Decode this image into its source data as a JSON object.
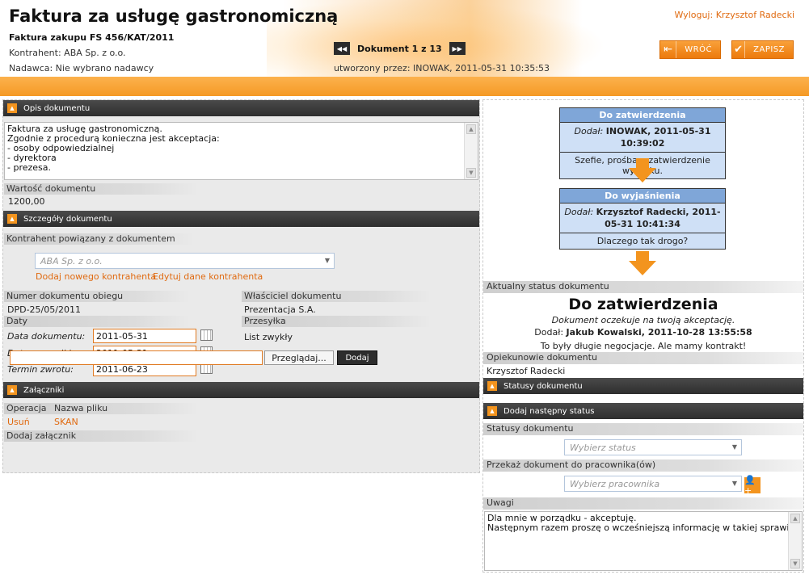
{
  "header": {
    "title": "Faktura za usługę gastronomiczną",
    "subtitle": "Faktura zakupu FS 456/KAT/2011",
    "contractor": "Kontrahent: ABA Sp. z o.o.",
    "sender": "Nadawca: Nie wybrano nadawcy",
    "logout": "Wyloguj: Krzysztof Radecki",
    "pager_text": "Dokument 1 z 13",
    "created_by": "utworzony przez: INOWAK, 2011-05-31 10:35:53",
    "back_label": "WRÓĆ",
    "save_label": "ZAPISZ"
  },
  "left": {
    "opis_title": "Opis dokumentu",
    "opis_lines": [
      "Faktura za usługę gastronomiczną.",
      "Zgodnie z procedurą konieczna jest akceptacja:",
      "- osoby odpowiedzialnej",
      "- dyrektora",
      "- prezesa."
    ],
    "value_label": "Wartość dokumentu",
    "value": "1200,00",
    "details_title": "Szczegóły dokumentu",
    "contractor_label": "Kontrahent powiązany z dokumentem",
    "contractor_select": "ABA Sp. z o.o.",
    "add_contractor": "Dodaj nowego kontrahenta",
    "edit_contractor": "Edytuj dane kontrahenta",
    "doc_number_label": "Numer dokumentu obiegu",
    "doc_number": "DPD-25/05/2011",
    "owner_label": "Właściciel dokumentu",
    "owner": "Prezentacja S.A.",
    "dates_label": "Daty",
    "shipment_label": "Przesyłka",
    "shipment": "List zwykły",
    "date_doc_label": "Data dokumentu:",
    "date_doc": "2011-05-31",
    "date_ship_label": "Data przesyłki:",
    "date_ship": "2011-05-31",
    "date_return_label": "Termin zwrotu:",
    "date_return": "2011-06-23",
    "attachments_title": "Załączniki",
    "col_operation": "Operacja",
    "col_filename": "Nazwa pliku",
    "delete_link": "Usuń",
    "file_name": "SKAN",
    "add_attachment_label": "Dodaj załącznik",
    "browse_label": "Przeglądaj...",
    "add_label": "Dodaj"
  },
  "right": {
    "wf1": {
      "status": "Do zatwierdzenia",
      "by_prefix": "Dodał:",
      "by": "INOWAK, 2011-05-31 10:39:02",
      "note": "Szefie, prośba o zatwierdzenie wydatku."
    },
    "wf2": {
      "status": "Do wyjaśnienia",
      "by_prefix": "Dodał:",
      "by": "Krzysztof Radecki, 2011-05-31 10:41:34",
      "note": "Dlaczego tak drogo?"
    },
    "current_status_label": "Aktualny status dokumentu",
    "current_status": "Do zatwierdzenia",
    "current_note": "Dokument oczekuje na twoją akceptację.",
    "current_by_prefix": "Dodał:",
    "current_by": "Jakub Kowalski, 2011-10-28 13:55:58",
    "current_comment": "To były długie negocjacje. Ale mamy kontrakt!",
    "guardians_label": "Opiekunowie dokumentu",
    "guardian": "Krzysztof Radecki",
    "statuses_title": "Statusy dokumentu",
    "add_status_title": "Dodaj następny status",
    "statuses_label": "Statusy dokumentu",
    "status_select": "Wybierz status",
    "forward_label": "Przekaż dokument do pracownika(ów)",
    "employee_select": "Wybierz pracownika",
    "notes_label": "Uwagi",
    "notes_lines": [
      "Dla mnie w porządku - akceptuję.",
      "Następnym razem proszę o wcześniejszą informację w takiej sprawie."
    ]
  },
  "colors": {
    "accent": "#f3941e",
    "link": "#e06a10",
    "workflow_head": "#7fa6d8",
    "workflow_body": "#cfe0f6",
    "section_head": "#3a3a3a"
  },
  "icons": {
    "prev": "double-left-arrow-icon",
    "next": "double-right-arrow-icon",
    "back": "back-arrow-icon",
    "save": "check-icon",
    "toggle": "collapse-icon",
    "calendar": "calendar-icon",
    "add_user": "add-user-icon",
    "flow": "down-arrow-icon"
  }
}
